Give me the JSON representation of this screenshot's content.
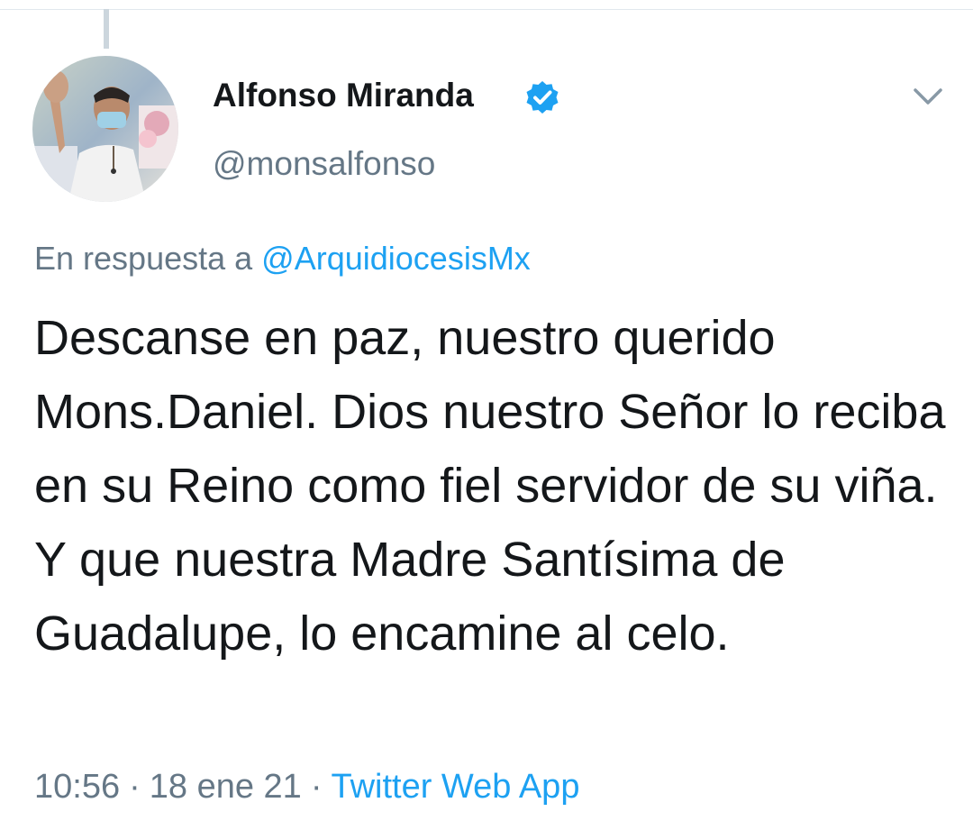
{
  "tweet": {
    "author": {
      "display_name": "Alfonso Miranda",
      "handle": "@monsalfonso",
      "verified": true
    },
    "reply_to": {
      "prefix": "En respuesta a",
      "handle": "@ArquidiocesisMx"
    },
    "text": "Descanse en paz, nuestro querido Mons.Daniel. Dios nuestro Señor lo reciba en su Reino como fiel servidor de su viña. Y que nuestra Madre Santísima de Guadalupe, lo encamine al celo.",
    "time": "10:56",
    "separator": "·",
    "date": "18 ene 21",
    "source": "Twitter Web App"
  },
  "icons": {
    "verified": "verified-badge-icon",
    "menu": "chevron-down-icon"
  },
  "colors": {
    "accent": "#1da1f2",
    "text": "#14171a",
    "muted": "#657786",
    "thread_line": "#ccd6dd"
  }
}
